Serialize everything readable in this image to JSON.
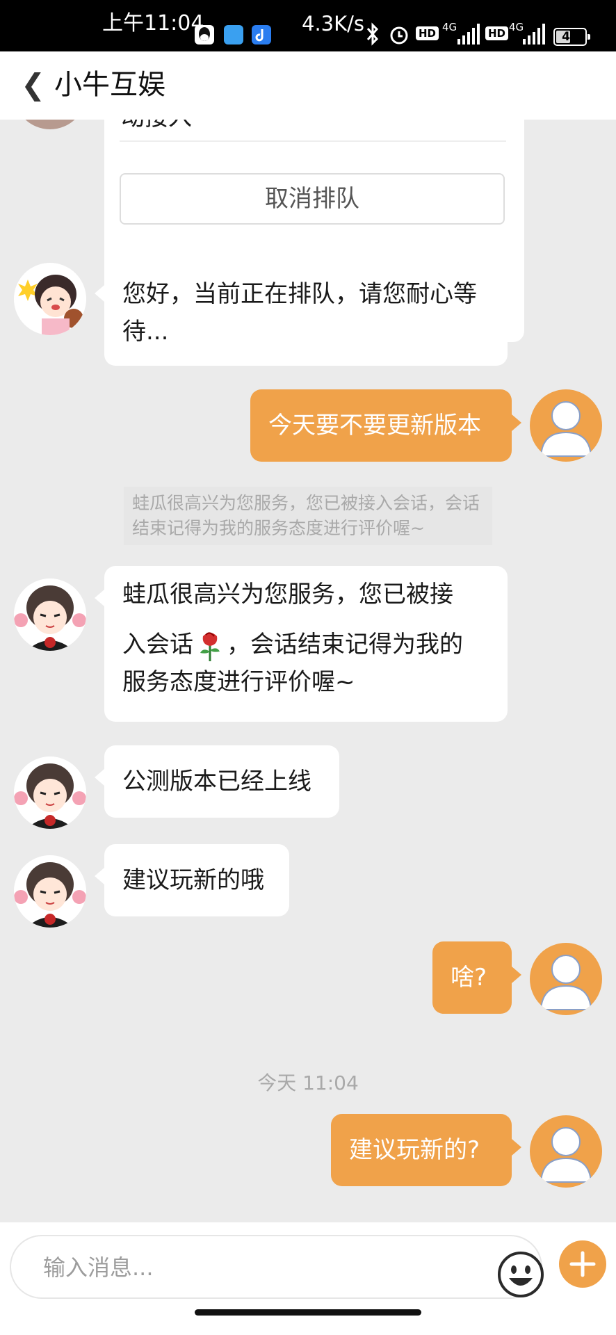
{
  "status_bar": {
    "time": "上午11:04",
    "net_speed": "4.3K/s",
    "network_1": "4G",
    "network_2": "4G",
    "hd_1": "HD",
    "hd_2": "HD",
    "battery": "49",
    "icons": [
      "qq-icon",
      "app-icon",
      "tiktok-icon",
      "bluetooth-icon",
      "alarm-icon",
      "signal-icon",
      "signal-icon",
      "battery-icon"
    ]
  },
  "header": {
    "back_icon": "chevron-left-icon",
    "title": "小牛互娱"
  },
  "chat": {
    "queue_card": {
      "partial_text": "动接入",
      "cancel_button": "取消排队"
    },
    "messages": [
      {
        "side": "left",
        "avatar": "avatar-anime-girl",
        "text": "您好，当前正在排队，请您耐心等待..."
      },
      {
        "side": "right",
        "avatar": "avatar-user-default",
        "text": "今天要不要更新版本"
      },
      {
        "side": "system",
        "text": "蛙瓜很高兴为您服务，您已被接入会话，会话结束记得为我的服务态度进行评价喔~"
      },
      {
        "side": "left",
        "avatar": "avatar-anime-boy",
        "text_a": "蛙瓜很高兴为您服务，您已被接",
        "text_b": "入会话",
        "text_c": "，会话结束记得为我的",
        "text_d": "服务态度进行评价喔~",
        "emoji": "rose-icon"
      },
      {
        "side": "left",
        "avatar": "avatar-anime-boy",
        "text": "公测版本已经上线"
      },
      {
        "side": "left",
        "avatar": "avatar-anime-boy",
        "text": "建议玩新的哦"
      },
      {
        "side": "right",
        "avatar": "avatar-user-default",
        "text": "啥?"
      },
      {
        "side": "right",
        "avatar": "avatar-user-default",
        "text": "建议玩新的?"
      }
    ],
    "timestamp": "今天 11:04"
  },
  "input_bar": {
    "placeholder": "输入消息...",
    "emoji_icon": "smile-icon",
    "plus_icon": "plus-icon"
  },
  "colors": {
    "accent": "#f0a24a",
    "background": "#ebebeb",
    "bubble_left": "#ffffff"
  }
}
